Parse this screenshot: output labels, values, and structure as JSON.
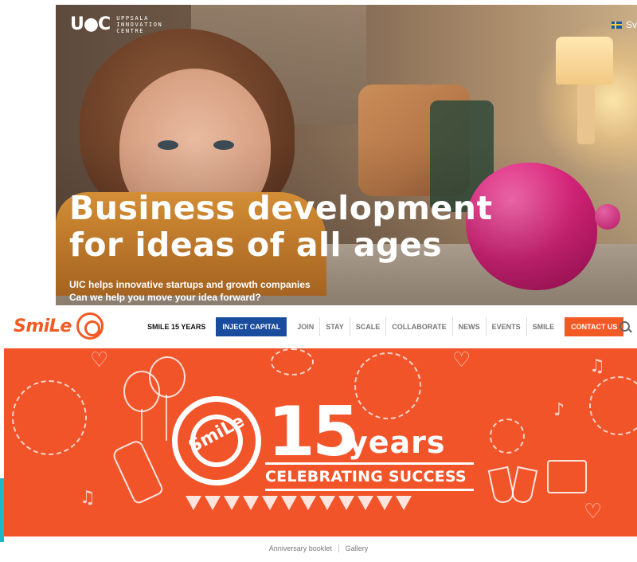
{
  "uic": {
    "logo_mark": "U●C",
    "logo_lines": [
      "UPPSALA",
      "INNOVATION",
      "CENTRE"
    ],
    "language": "Sv",
    "headline_line1": "Business development",
    "headline_line2": "for ideas of all ages",
    "sub_line1": "UIC helps innovative startups and growth companies",
    "sub_line2": "Can we help you move your idea forward?"
  },
  "smile": {
    "wordmark": "SmiLe",
    "nav": {
      "smile15": "SMILE 15 YEARS",
      "inject": "INJECT CAPITAL",
      "join": "JOIN",
      "stay": "STAY",
      "scale": "SCALE",
      "collaborate": "COLLABORATE",
      "news": "NEWS",
      "events": "EVENTS",
      "smile": "SMILE",
      "contact": "CONTACT US"
    },
    "banner": {
      "emblem": "SmiLe",
      "number": "15",
      "years": "years",
      "tagline": "CELEBRATING SUCCESS"
    },
    "links": {
      "booklet": "Anniversary booklet",
      "gallery": "Gallery"
    }
  },
  "colors": {
    "smile_orange": "#f15a24",
    "inject_blue": "#1a4c9e",
    "banner_bg": "#f2542a"
  }
}
